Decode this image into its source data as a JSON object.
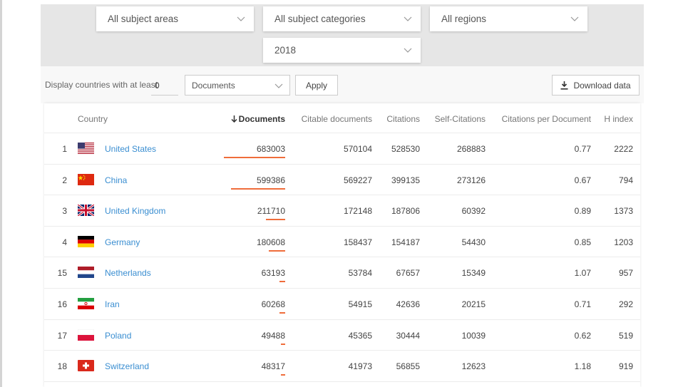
{
  "filters": {
    "subject_area": "All subject areas",
    "subject_category": "All subject categories",
    "region": "All regions",
    "year": "2018"
  },
  "controls": {
    "min_label": "Display countries with at least",
    "min_value": "0",
    "metric": "Documents",
    "apply_label": "Apply",
    "download_label": "Download data"
  },
  "table": {
    "columns": [
      "Country",
      "Documents",
      "Citable documents",
      "Citations",
      "Self-Citations",
      "Citations per Document",
      "H index"
    ],
    "sort_column": "Documents",
    "sort_direction": "descending",
    "rows": [
      {
        "rank": "1",
        "country": "United States",
        "flag": "us-flag",
        "documents": "683003",
        "documents_fraction": 1.0,
        "citable": "570104",
        "citations": "528530",
        "self_citations": "268883",
        "cpd": "0.77",
        "h": "2222"
      },
      {
        "rank": "2",
        "country": "China",
        "flag": "china-flag",
        "documents": "599386",
        "documents_fraction": 0.878,
        "citable": "569227",
        "citations": "399135",
        "self_citations": "273126",
        "cpd": "0.67",
        "h": "794"
      },
      {
        "rank": "3",
        "country": "United Kingdom",
        "flag": "uk-flag",
        "documents": "211710",
        "documents_fraction": 0.31,
        "citable": "172148",
        "citations": "187806",
        "self_citations": "60392",
        "cpd": "0.89",
        "h": "1373"
      },
      {
        "rank": "4",
        "country": "Germany",
        "flag": "germany-flag",
        "documents": "180608",
        "documents_fraction": 0.264,
        "citable": "158437",
        "citations": "154187",
        "self_citations": "54430",
        "cpd": "0.85",
        "h": "1203"
      },
      {
        "rank": "15",
        "country": "Netherlands",
        "flag": "netherlands-flag",
        "documents": "63193",
        "documents_fraction": 0.093,
        "citable": "53784",
        "citations": "67657",
        "self_citations": "15349",
        "cpd": "1.07",
        "h": "957"
      },
      {
        "rank": "16",
        "country": "Iran",
        "flag": "iran-flag",
        "documents": "60268",
        "documents_fraction": 0.088,
        "citable": "54915",
        "citations": "42636",
        "self_citations": "20215",
        "cpd": "0.71",
        "h": "292"
      },
      {
        "rank": "17",
        "country": "Poland",
        "flag": "poland-flag",
        "documents": "49488",
        "documents_fraction": 0.072,
        "citable": "45365",
        "citations": "30444",
        "self_citations": "10039",
        "cpd": "0.62",
        "h": "519"
      },
      {
        "rank": "18",
        "country": "Switzerland",
        "flag": "switzerland-flag",
        "documents": "48317",
        "documents_fraction": 0.071,
        "citable": "41973",
        "citations": "56855",
        "self_citations": "12623",
        "cpd": "1.18",
        "h": "919"
      }
    ]
  },
  "colors": {
    "link": "#3a8ed1",
    "bar": "#ef6d3b",
    "filter_bg": "#e6e6e6"
  },
  "icons": [
    "chevron-down-icon",
    "download-icon",
    "sort-arrow-down-icon"
  ]
}
